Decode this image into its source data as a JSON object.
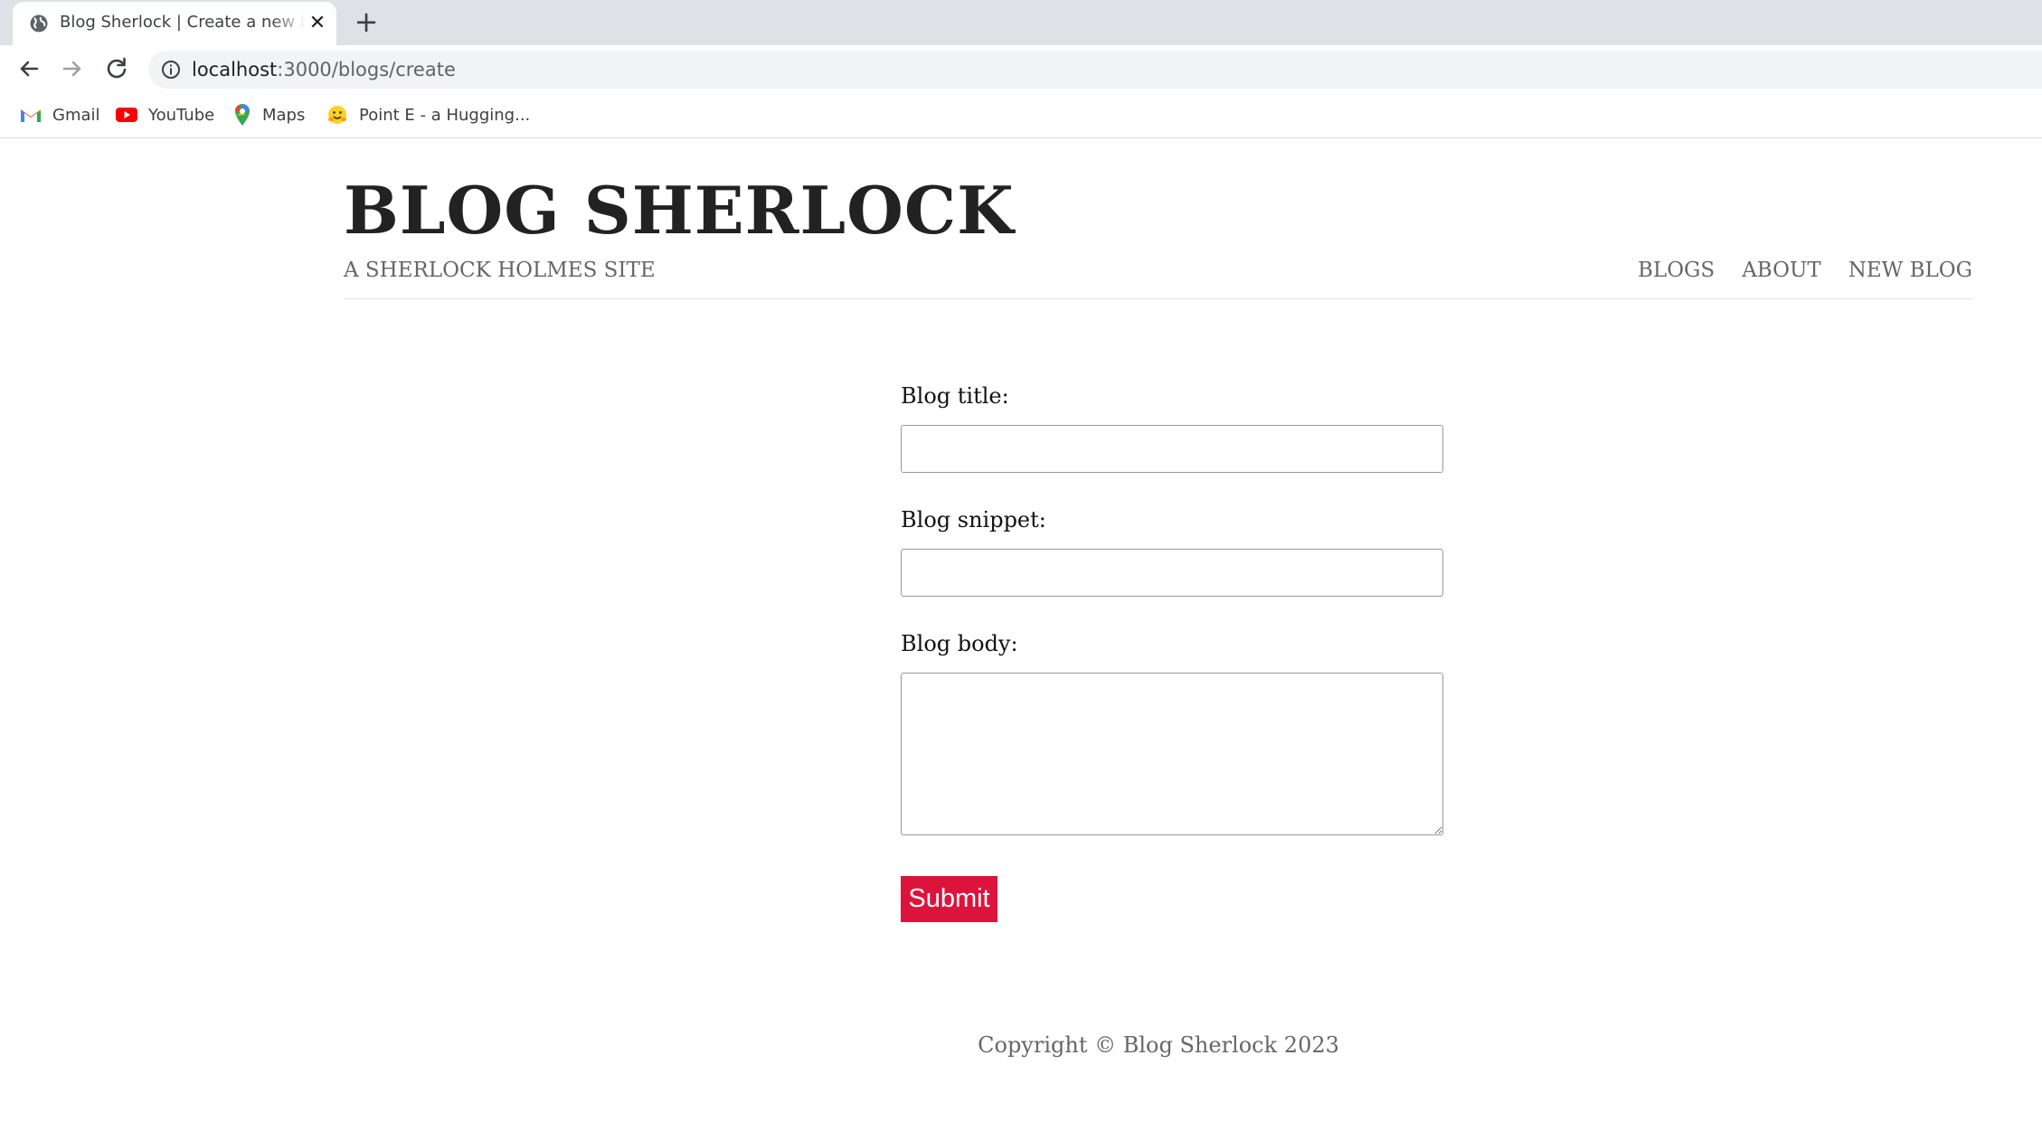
{
  "browser": {
    "tab_title": "Blog Sherlock | Create a new blog",
    "new_tab_label": "+",
    "close_label": "✕",
    "url_host": "localhost",
    "url_path": ":3000/blogs/create",
    "bookmarks": [
      {
        "label": "Gmail",
        "icon": "gmail-icon"
      },
      {
        "label": "YouTube",
        "icon": "youtube-icon"
      },
      {
        "label": "Maps",
        "icon": "maps-icon"
      },
      {
        "label": "Point E - a Hugging...",
        "icon": "hugging-face-icon"
      }
    ]
  },
  "site": {
    "title": "BLOG SHERLOCK",
    "subtitle": "A SHERLOCK HOLMES SITE",
    "nav": [
      "BLOGS",
      "ABOUT",
      "NEW BLOG"
    ]
  },
  "form": {
    "title_label": "Blog title:",
    "title_value": "",
    "snippet_label": "Blog snippet:",
    "snippet_value": "",
    "body_label": "Blog body:",
    "body_value": "",
    "submit_label": "Submit"
  },
  "footer": {
    "copyright": "Copyright © Blog Sherlock 2023"
  },
  "colors": {
    "accent": "#dc143c",
    "title": "#222222",
    "muted": "#666666"
  }
}
